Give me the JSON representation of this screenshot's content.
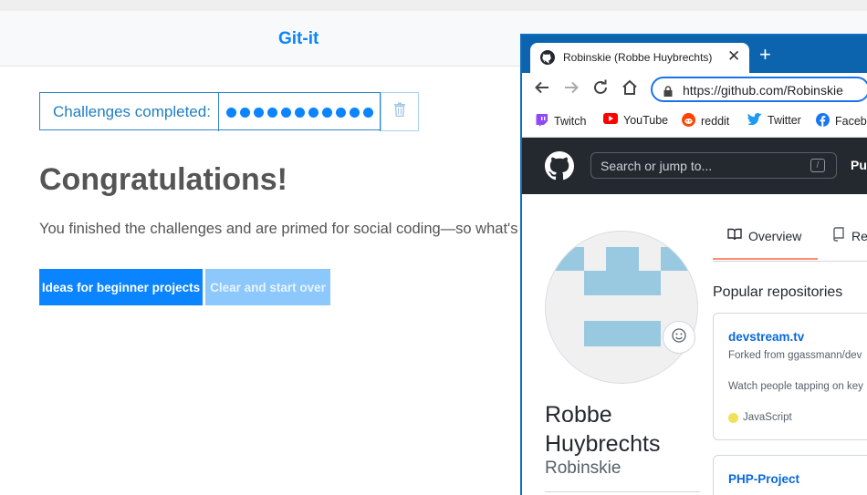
{
  "app": {
    "title": "Git-it",
    "counter_label": "Challenges completed:",
    "challenges_completed": 11,
    "heading": "Congratulations!",
    "message": "You finished the challenges and are primed for social coding—so what's ",
    "btn_ideas": "Ideas for beginner projects",
    "btn_clear": "Clear and start over",
    "accent": "#0a84ff"
  },
  "browser": {
    "tab_title": "Robinskie (Robbe Huybrechts)",
    "url": "https://github.com/Robinskie",
    "bookmarks": [
      "Twitch",
      "YouTube",
      "reddit",
      "Twitter",
      "Facebo"
    ]
  },
  "github": {
    "search_placeholder": "Search or jump to...",
    "search_key": "/",
    "header_partial": "Pul",
    "tabs": [
      "Overview",
      "Re"
    ],
    "fullname": "Robbe Huybrechts",
    "username": "Robinskie",
    "popular_heading": "Popular repositories",
    "repos": [
      {
        "name": "devstream.tv",
        "fork": "Forked from ggassmann/dev",
        "desc": "Watch people tapping on key",
        "lang": "JavaScript"
      },
      {
        "name": "PHP-Project"
      }
    ]
  },
  "icons": {
    "trash": "trash-icon",
    "github": "github-logo-icon",
    "back": "back-arrow-icon",
    "forward": "forward-arrow-icon",
    "reload": "reload-icon",
    "home": "home-icon",
    "lock": "lock-icon",
    "book": "book-icon",
    "repo": "repo-icon",
    "smiley": "smiley-icon"
  }
}
